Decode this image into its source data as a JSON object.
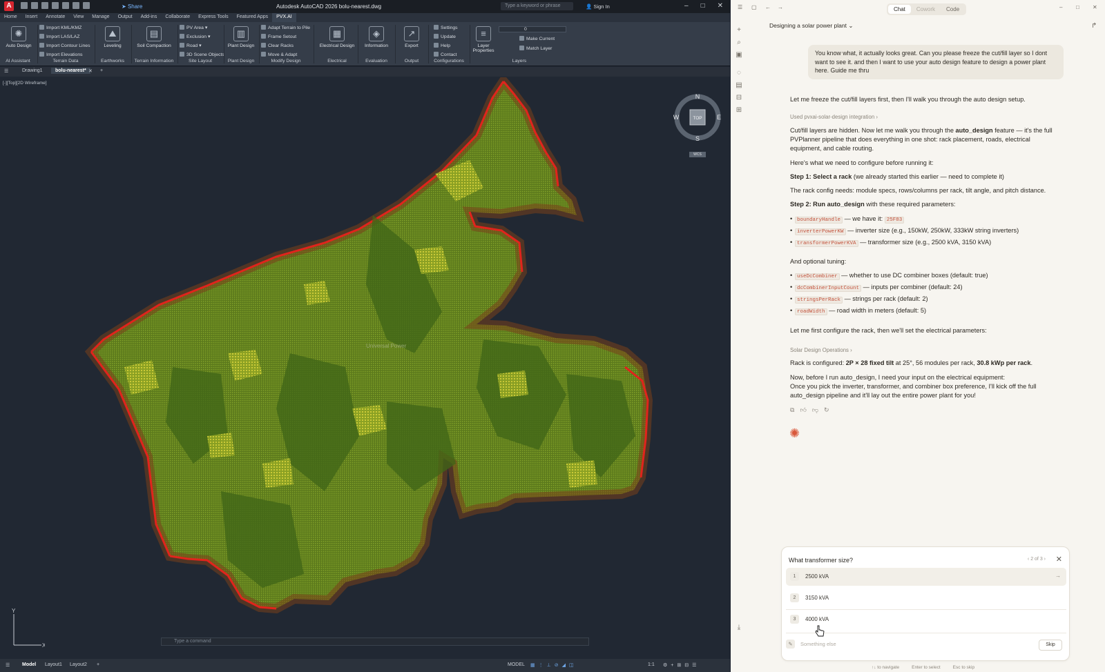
{
  "acad": {
    "app_badge": "A",
    "share_label": "Share",
    "title": "Autodesk AutoCAD 2026   bolu-nearest.dwg",
    "search_placeholder": "Type a keyword or phrase",
    "signin": "Sign In",
    "ribbon_tabs": [
      "Home",
      "Insert",
      "Annotate",
      "View",
      "Manage",
      "Output",
      "Add-ins",
      "Collaborate",
      "Express Tools",
      "Featured Apps",
      "PVX.AI"
    ],
    "active_tab": "PVX.AI",
    "ribbon": {
      "ai_assistant": {
        "button": "Auto Design",
        "panel": "AI Assistant"
      },
      "terrain_data": {
        "items": [
          "Import KML/KMZ",
          "Import LAS/LAZ",
          "Import Contour Lines",
          "Import Elevations"
        ],
        "panel": "Terrain Data"
      },
      "earthworks": {
        "button": "Leveling",
        "panel": "Earthworks"
      },
      "terrain_info": {
        "button": "Soil Compaction",
        "panel": "Terrain Information"
      },
      "site_layout": {
        "items": [
          "PV Area",
          "Exclusion",
          "Road",
          "3D Scene Objects"
        ],
        "panel": "Site Layout"
      },
      "plant_design": {
        "button": "Plant Design",
        "panel": "Plant Design"
      },
      "modify_design": {
        "items": [
          "Adapt Terrain to Pile",
          "Frame Setout",
          "Clear Racks",
          "Move & Adapt"
        ],
        "panel": "Modify Design"
      },
      "electrical": {
        "button": "Electrical Design",
        "panel": "Electrical"
      },
      "evaluation": {
        "button": "Information",
        "panel": "Evaluation"
      },
      "output": {
        "button": "Export",
        "panel": "Output"
      },
      "configurations": {
        "items": [
          "Settings",
          "Update",
          "Help",
          "Contact"
        ],
        "panel": "Configurations"
      },
      "layers": {
        "button": "Layer Properties",
        "layer_value": "0",
        "make_current": "Make Current",
        "match_layer": "Match Layer",
        "panel": "Layers"
      }
    },
    "doc_tabs": [
      "Drawing1",
      "bolu-nearest*"
    ],
    "viewport_label": "[-][Top][2D Wireframe]",
    "compass": {
      "n": "N",
      "s": "S",
      "e": "E",
      "w": "W",
      "top": "TOP",
      "wcs": "WCS"
    },
    "command_placeholder": "Type a command",
    "layout_tabs": [
      "Model",
      "Layout1",
      "Layout2"
    ],
    "model_label": "MODEL",
    "scale": "1:1",
    "watermark": "Universal Power",
    "colors": {
      "boundary": "#e0241c",
      "terrain": "#5f7d1e",
      "background": "#212833"
    }
  },
  "claude": {
    "modes": [
      "Chat",
      "Cowork",
      "Code"
    ],
    "active_mode": "Chat",
    "conversation_title": "Designing a solar power plant",
    "user_message": "You know what, it actually looks great. Can you please freeze the cut/fill layer so I dont want to see it. and then I want to use your auto design feature to design a power plant here. Guide me thru",
    "msg1": "Let me freeze the cut/fill layers first, then I'll walk you through the auto design setup.",
    "tool1": "Used pvxai-solar-design integration",
    "msg2a": "Cut/fill layers are hidden. Now let me walk you through the ",
    "msg2b": "auto_design",
    "msg2c": " feature — it's the full PVPlanner pipeline that does everything in one shot: rack placement, roads, electrical equipment, and cable routing.",
    "msg3": "Here's what we need to configure before running it:",
    "step1_bold": "Step 1: Select a rack",
    "step1_rest": " (we already started this earlier — need to complete it)",
    "rack_config": "The rack config needs: module specs, rows/columns per rack, tilt angle, and pitch distance.",
    "step2_bold": "Step 2: Run auto_design",
    "step2_rest": " with these required parameters:",
    "required": [
      {
        "code": "boundaryHandle",
        "text": " — we have it: ",
        "extra": "25F83"
      },
      {
        "code": "inverterPowerKW",
        "text": " — inverter size (e.g., 150kW, 250kW, 333kW string inverters)",
        "extra": ""
      },
      {
        "code": "transformerPowerKVA",
        "text": " — transformer size (e.g., 2500 kVA, 3150 kVA)",
        "extra": ""
      }
    ],
    "optional_heading": "And optional tuning:",
    "optional": [
      {
        "code": "useDcCombiner",
        "text": " — whether to use DC combiner boxes (default: true)"
      },
      {
        "code": "dcCombinerInputCount",
        "text": " — inputs per combiner (default: 24)"
      },
      {
        "code": "stringsPerRack",
        "text": " — strings per rack (default: 2)"
      },
      {
        "code": "roadWidth",
        "text": " — road width in meters (default: 5)"
      }
    ],
    "msg4": "Let me first configure the rack, then we'll set the electrical parameters:",
    "tool2": "Solar Design Operations",
    "rack_result_a": "Rack is configured: ",
    "rack_result_b": "2P × 28 fixed tilt",
    "rack_result_c": " at 25°, 56 modules per rack, ",
    "rack_result_d": "30.8 kWp per rack",
    "rack_result_e": ".",
    "msg5": "Now, before I run auto_design, I need your input on the electrical equipment:",
    "msg6": "Once you pick the inverter, transformer, and combiner box preference, I'll kick off the full auto_design pipeline and it'll lay out the entire power plant for you!",
    "question": {
      "title": "What transformer size?",
      "pager": "2 of 3",
      "options": [
        {
          "num": "1",
          "label": "2500 kVA"
        },
        {
          "num": "2",
          "label": "3150 kVA"
        },
        {
          "num": "3",
          "label": "4000 kVA"
        }
      ],
      "other_placeholder": "Something else",
      "skip": "Skip"
    },
    "hints": [
      "↑↓ to navigate",
      "Enter to select",
      "Esc to skip"
    ]
  }
}
